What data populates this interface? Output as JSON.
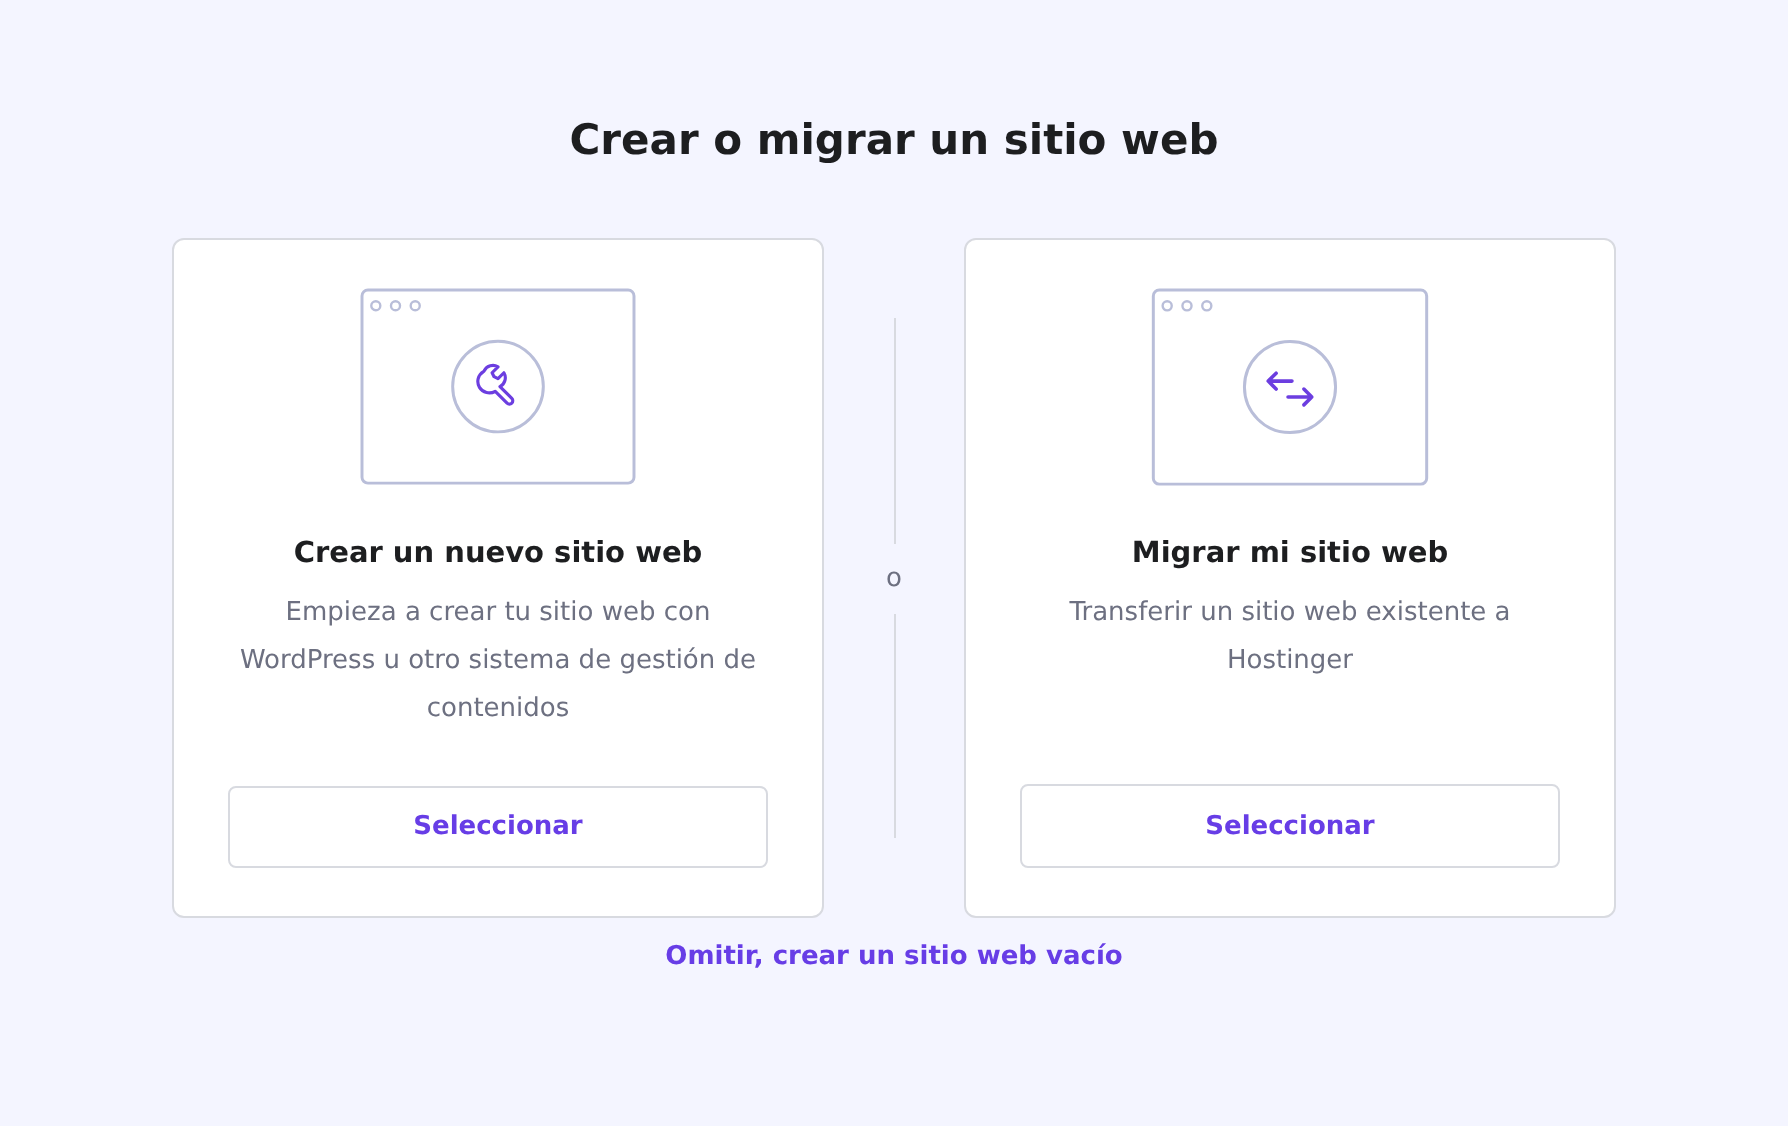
{
  "title": "Crear o migrar un sitio web",
  "options": [
    {
      "kind": "create",
      "heading": "Crear un nuevo sitio web",
      "description": "Empieza a crear tu sitio web con WordPress u otro sistema de gestión de contenidos",
      "button": "Seleccionar"
    },
    {
      "kind": "migrate",
      "heading": "Migrar mi sitio web",
      "description": "Transferir un sitio web existente a Hostinger",
      "button": "Seleccionar"
    }
  ],
  "separator": "o",
  "skip_link": "Omitir, crear un sitio web vacío"
}
